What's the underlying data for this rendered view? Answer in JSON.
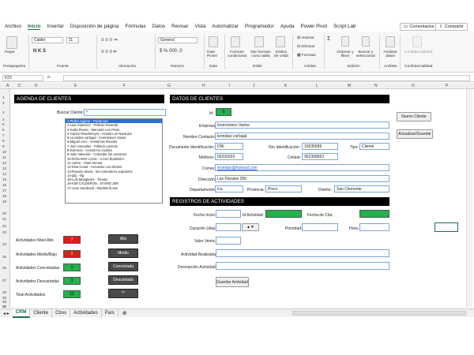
{
  "menu": {
    "items": [
      "Archivo",
      "Inicio",
      "Insertar",
      "Disposición de página",
      "Fórmulas",
      "Datos",
      "Revisar",
      "Vista",
      "Automatizar",
      "Programador",
      "Ayuda",
      "Power Pivot",
      "Script Lab"
    ],
    "comments": "Comentarios",
    "share": "Compartir"
  },
  "ribbon": {
    "paste": "Pegar",
    "clipboard": "Portapapeles",
    "font_group": "Fuente",
    "font_name": "Calibri",
    "font_size": "11",
    "align_group": "Alineación",
    "number_format": "General",
    "number_group": "Número",
    "date_group": "Date",
    "date_picker": "Date Picker",
    "styles_group": "Estilo",
    "cond_format": "Formato condicional",
    "format_table": "Dar formato como tabla",
    "cell_styles": "Estilos de celda",
    "cells_group": "Celdas",
    "insert": "Insertar",
    "delete": "Eliminar",
    "format": "Formato",
    "edit_group": "Edición",
    "sort": "Ordenar y filtrar",
    "find": "Buscar y seleccionar",
    "analysis_group": "Análisis",
    "analyze": "Analizar datos",
    "conf_group": "Confidencialidad",
    "conf": "Confidencialidad"
  },
  "formula_bar": {
    "cell_ref": "F23",
    "fx": "fx",
    "value": ""
  },
  "columns": [
    "A",
    "C",
    "D",
    "E",
    "F",
    "G",
    "H",
    "I",
    "J",
    "K",
    "L",
    "M",
    "N",
    "O",
    "P"
  ],
  "rows": [
    "1",
    "2",
    "3",
    "4",
    "5",
    "6",
    "7",
    "8",
    "9",
    "10",
    "11",
    "12",
    "13",
    "14",
    "15",
    "16",
    "17",
    "18",
    "19",
    "20",
    "21",
    "22",
    "23",
    "24",
    "25",
    "26",
    "27",
    "28",
    "29",
    "30",
    "31",
    "32"
  ],
  "agenda": {
    "title": "AGENDA DE CLIENTES",
    "search_label": "Buscar Cliente:",
    "search_value": "*",
    "clients": [
      "1-Pedro Aguirre - Portal Sur",
      "2-Luis Gutierrez - Polleria Rosedal",
      "3-Karla Rivera - Mercado Los Pinos",
      "4-Carlos Rivadeneyra - Hostal Los Naranjos",
      "5-Leonidas carbajal - Inversiones Varios",
      "6-Miguel Arce - Hostal las Ruedas",
      "7-Joel Gonzales - Polleria carmelo",
      "8-Gomeza - Consorcio Carlota",
      "9-Julio Valverde - Comedor los ancianos",
      "10-ROSARIO LAOS - CASA BUENDIA",
      "11-carlos - Hotel arenas",
      "12-Elsa Canal - Comedor Los Dioses",
      "13-Rosario Maria - los comedores populares",
      "14-qfg - sfg",
      "15-Luis Manglares - Tienda",
      "16-KIM CALDERON - STORE JBN",
      "17-Juan Sandoval - Mueblería san"
    ],
    "stats": [
      {
        "label": "Actividades Nivel Alto",
        "value": "7",
        "button": "Alto",
        "color": "red"
      },
      {
        "label": "Actividades Medio/Bajo",
        "value": "1",
        "button": "Medio",
        "color": "red"
      },
      {
        "label": "Actividades Concretadas",
        "value": "1",
        "button": "Concretada",
        "color": "green"
      },
      {
        "label": "Actividades Descartadas",
        "value": "3",
        "button": "Descartada",
        "color": "green"
      },
      {
        "label": "Total Actividades",
        "value": "12",
        "button": "**",
        "color": "green"
      }
    ]
  },
  "datos": {
    "title": "DATOS DE CLIENTES",
    "id_label": "Id:",
    "id_value": "5",
    "empresa_label": "Empresa:",
    "empresa": "Inversiones Varios",
    "contacto_label": "Nombre Contacto:",
    "contacto": "leonidas carbajal",
    "docid_label": "Documento Identificación:",
    "docid": "DNI",
    "nroid_label": "Nro Identificación:",
    "nroid": "10635689",
    "tipo_label": "Tipo:",
    "tipo": "Cliente",
    "telefono_label": "Teléfono:",
    "telefono": "56326933",
    "celular_label": "Celular:",
    "celular": "952368563",
    "correo_label": "Correo:",
    "correo": "leonidas@hotmail.com",
    "direccion_label": "Dirección:",
    "direccion": "Las Florales 256",
    "depto_label": "Departamento:",
    "depto": "Ica",
    "prov_label": "Provincia:",
    "prov": "Pisco",
    "dist_label": "Distrito:",
    "dist": "San Clemente",
    "btn_new": "Nuevo Cliente",
    "btn_save": "Actualizar/Guardar"
  },
  "registros": {
    "title": "REGISTROS DE ACTIVIDADES",
    "fecha_inicio": "Fecha Inicio:",
    "id_act": "Id Actividad:",
    "fecha_cita": "Fecha de Cita:",
    "duracion": "Duración (días):",
    "prioridad": "Prioridad:",
    "hora": "Hora:",
    "valor_venta": "Valor Venta:",
    "act_realizada": "Actividad Realizada:",
    "desc_act": "Descripción Actividad:",
    "btn_save": "Guardar Actividad"
  },
  "sheets": [
    "CRM",
    "Cliente",
    "Cbos",
    "Actividades",
    "País"
  ],
  "colors": {
    "green": "#22b14c",
    "red": "#e01a1a",
    "black_header": "#000000",
    "excel_green": "#1e7145"
  }
}
